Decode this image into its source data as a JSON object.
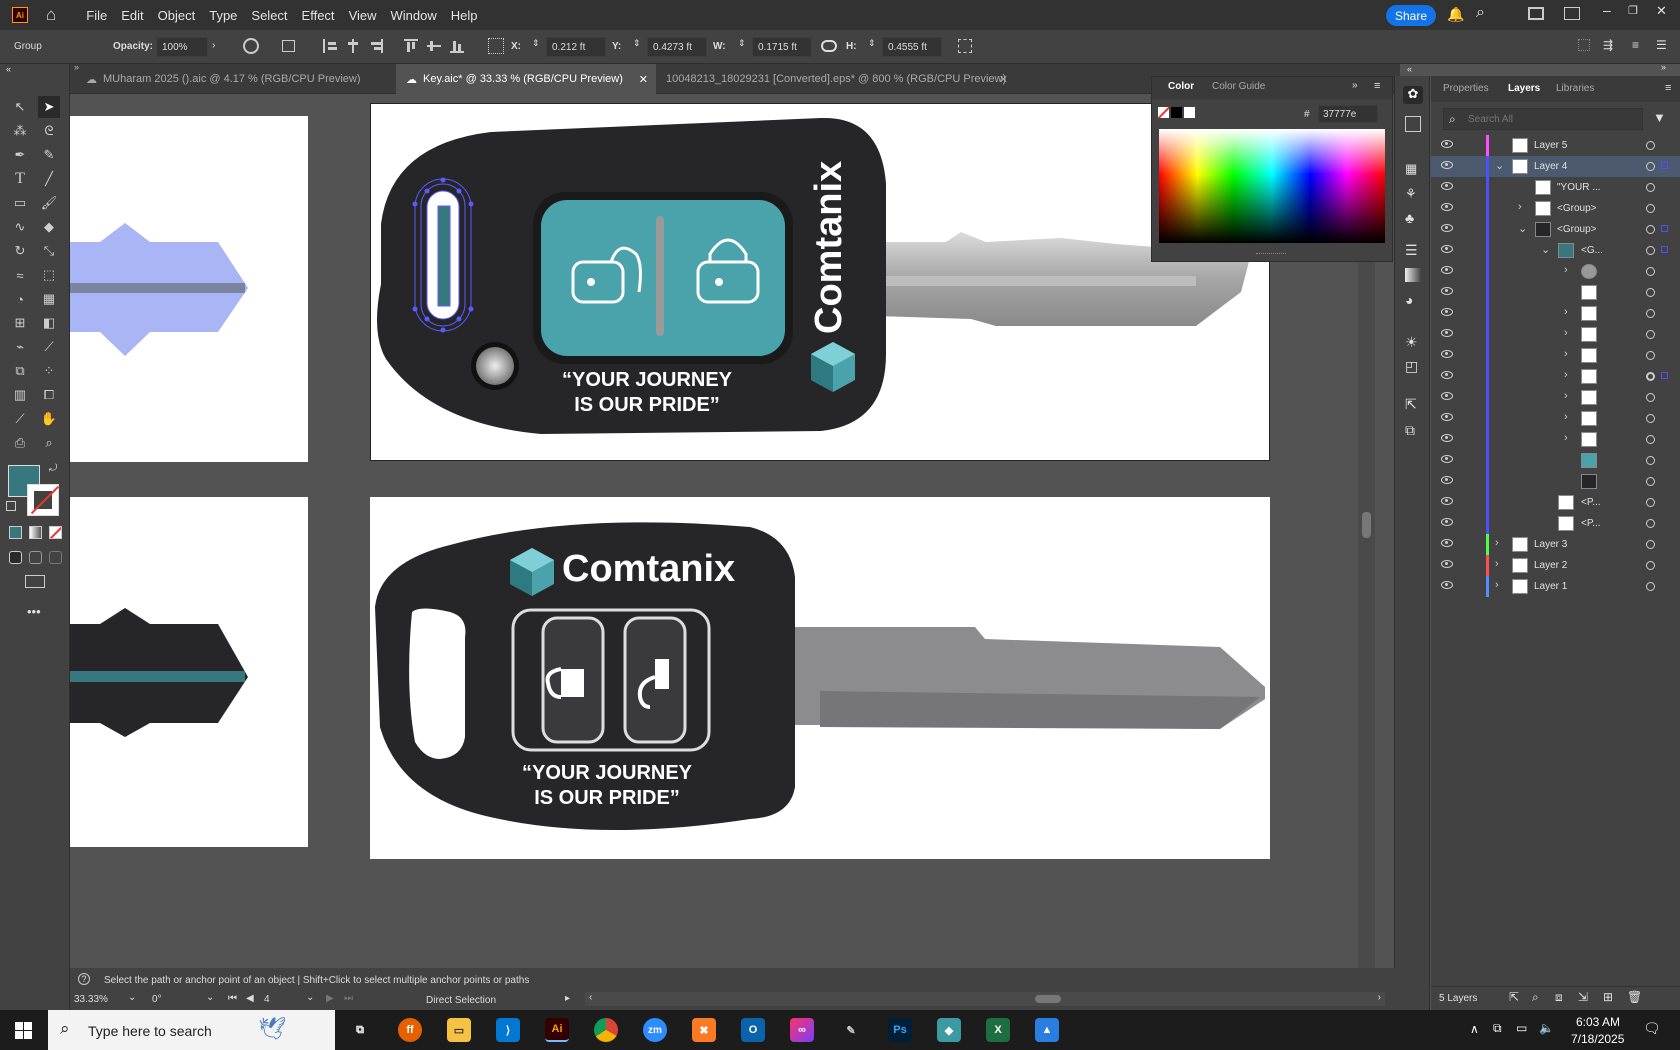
{
  "menubar": {
    "app_icon": "Ai",
    "items": [
      "File",
      "Edit",
      "Object",
      "Type",
      "Select",
      "Effect",
      "View",
      "Window",
      "Help"
    ],
    "share_label": "Share"
  },
  "controlbar": {
    "selection_type": "Group",
    "opacity_label": "Opacity:",
    "opacity_value": "100%",
    "x_label": "X:",
    "x_value": "0.212 ft",
    "y_label": "Y:",
    "y_value": "0.4273 ft",
    "w_label": "W:",
    "w_value": "0.1715 ft",
    "h_label": "H:",
    "h_value": "0.4555 ft"
  },
  "tabs": [
    {
      "label": "MUharam 2025 ().aic @ 4.17 % (RGB/CPU Preview)"
    },
    {
      "label": "Key.aic* @ 33.33 % (RGB/CPU Preview)"
    },
    {
      "label": "10048213_18029231 [Converted].eps* @ 800 % (RGB/CPU Preview)"
    }
  ],
  "artwork": {
    "brand_name": "Comtanix",
    "slogan_line1": "“YOUR JOURNEY",
    "slogan_line2": "IS OUR PRIDE”",
    "colors": {
      "fob_body": "#262628",
      "teal": "#37777e",
      "teal_light": "#4aa3ab",
      "blade": "#8c8c8e",
      "blade_lavender": "#a9b5f5",
      "blade_stripe": "#7b849e"
    }
  },
  "color_panel": {
    "tab_color": "Color",
    "tab_guide": "Color Guide",
    "hex_label": "#",
    "hex_value": "37777e"
  },
  "layers_panel": {
    "tabs": [
      "Properties",
      "Layers",
      "Libraries"
    ],
    "search_placeholder": "Search All",
    "rows": [
      {
        "name": "Layer 5",
        "color": "#ff4fff"
      },
      {
        "name": "Layer 4",
        "color": "#4f4fff"
      },
      {
        "name": "\"YOUR ...",
        "color": "#4f4fff"
      },
      {
        "name": "<Group>",
        "color": "#4f4fff"
      },
      {
        "name": "<Group>",
        "color": "#4f4fff"
      },
      {
        "name": "<G...",
        "color": "#4f4fff"
      },
      {
        "name": "",
        "color": "#4f4fff"
      },
      {
        "name": "",
        "color": "#4f4fff"
      },
      {
        "name": "",
        "color": "#4f4fff"
      },
      {
        "name": "",
        "color": "#4f4fff"
      },
      {
        "name": "",
        "color": "#4f4fff"
      },
      {
        "name": "",
        "color": "#4f4fff"
      },
      {
        "name": "",
        "color": "#4f4fff"
      },
      {
        "name": "",
        "color": "#4f4fff"
      },
      {
        "name": "",
        "color": "#4f4fff"
      },
      {
        "name": "",
        "color": "#4f4fff"
      },
      {
        "name": "",
        "color": "#4f4fff"
      },
      {
        "name": "",
        "color": "#4f4fff"
      },
      {
        "name": "<P...",
        "color": "#4f4fff"
      },
      {
        "name": "<P...",
        "color": "#4f4fff"
      },
      {
        "name": "Layer 3",
        "color": "#4fff4f"
      },
      {
        "name": "Layer 2",
        "color": "#ff4f4f"
      },
      {
        "name": "Layer 1",
        "color": "#4f8fff"
      }
    ],
    "footer_count": "5 Layers"
  },
  "statusbar": {
    "hint": "Select the path or anchor point of an object  |  Shift+Click to select multiple anchor points or paths",
    "zoom": "33.33%",
    "rotation": "0°",
    "artboard_num": "4",
    "tool_name": "Direct Selection"
  },
  "taskbar": {
    "search_placeholder": "Type here to search",
    "time": "6:03 AM",
    "date": "7/18/2025"
  }
}
